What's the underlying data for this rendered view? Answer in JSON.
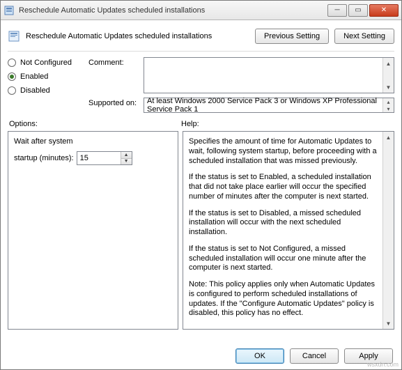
{
  "window": {
    "title": "Reschedule Automatic Updates scheduled installations"
  },
  "header": {
    "label": "Reschedule Automatic Updates scheduled installations",
    "prev_btn": "Previous Setting",
    "next_btn": "Next Setting"
  },
  "state": {
    "not_configured": "Not Configured",
    "enabled": "Enabled",
    "disabled": "Disabled",
    "selected": "enabled"
  },
  "comment": {
    "label": "Comment:",
    "value": ""
  },
  "supported": {
    "label": "Supported on:",
    "value": "At least Windows 2000 Service Pack 3 or Windows XP Professional Service Pack 1"
  },
  "section_labels": {
    "options": "Options:",
    "help": "Help:"
  },
  "options": {
    "line1": "Wait after system",
    "line2_label": "startup (minutes):",
    "value": "15"
  },
  "help": {
    "p1": "Specifies the amount of time for Automatic Updates to wait, following system startup, before proceeding with a scheduled installation that was missed previously.",
    "p2": "If the status is set to Enabled, a scheduled installation that did not take place earlier will occur the specified number of minutes after the computer is next started.",
    "p3": "If the status is set to Disabled, a missed scheduled installation will occur with the next scheduled installation.",
    "p4": "If the status is set to Not Configured, a missed scheduled installation will occur one minute after the computer is next started.",
    "p5": "Note: This policy applies only when Automatic Updates is configured to perform scheduled installations of updates. If the \"Configure Automatic Updates\" policy is disabled, this policy has no effect."
  },
  "footer": {
    "ok": "OK",
    "cancel": "Cancel",
    "apply": "Apply"
  },
  "watermark": "wsxdn.com"
}
